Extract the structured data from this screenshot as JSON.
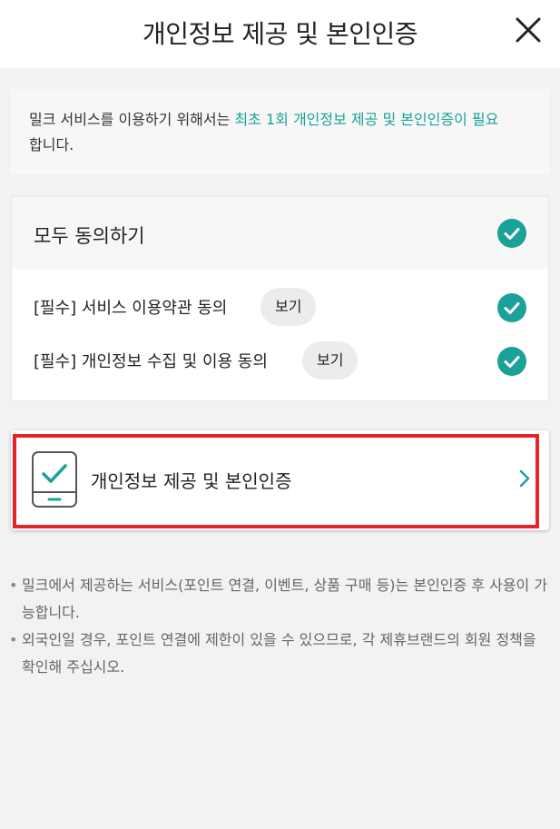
{
  "header": {
    "title": "개인정보 제공 및 본인인증",
    "close_icon": "close-icon"
  },
  "notice": {
    "prefix": "밀크 서비스를 이용하기 위해서는 ",
    "highlight": "최초 1회 개인정보 제공 및 본인인증이 필요",
    "suffix": "합니다.",
    "highlight_color": "#1aa19a"
  },
  "agreements": {
    "all": {
      "label": "모두 동의하기",
      "checked": true
    },
    "items": [
      {
        "label": "[필수] 서비스 이용약관 동의",
        "view_label": "보기",
        "checked": true
      },
      {
        "label": "[필수] 개인정보 수집 및 이용 동의",
        "view_label": "보기",
        "checked": true
      }
    ]
  },
  "auth": {
    "label": "개인정보 제공 및 본인인증",
    "icon": "phone-check-icon",
    "chevron_icon": "chevron-right-icon",
    "highlight_color": "#e6232b"
  },
  "info": [
    "밀크에서 제공하는 서비스(포인트 연결, 이벤트, 상품 구매 등)는 본인인증 후 사용이 가능합니다.",
    "외국인일 경우, 포인트 연결에 제한이 있을 수 있으므로, 각 제휴브랜드의 회원 정책을 확인해 주십시오."
  ],
  "colors": {
    "accent": "#1aa19a",
    "background": "#f2f2f2",
    "highlight_border": "#e6232b"
  }
}
